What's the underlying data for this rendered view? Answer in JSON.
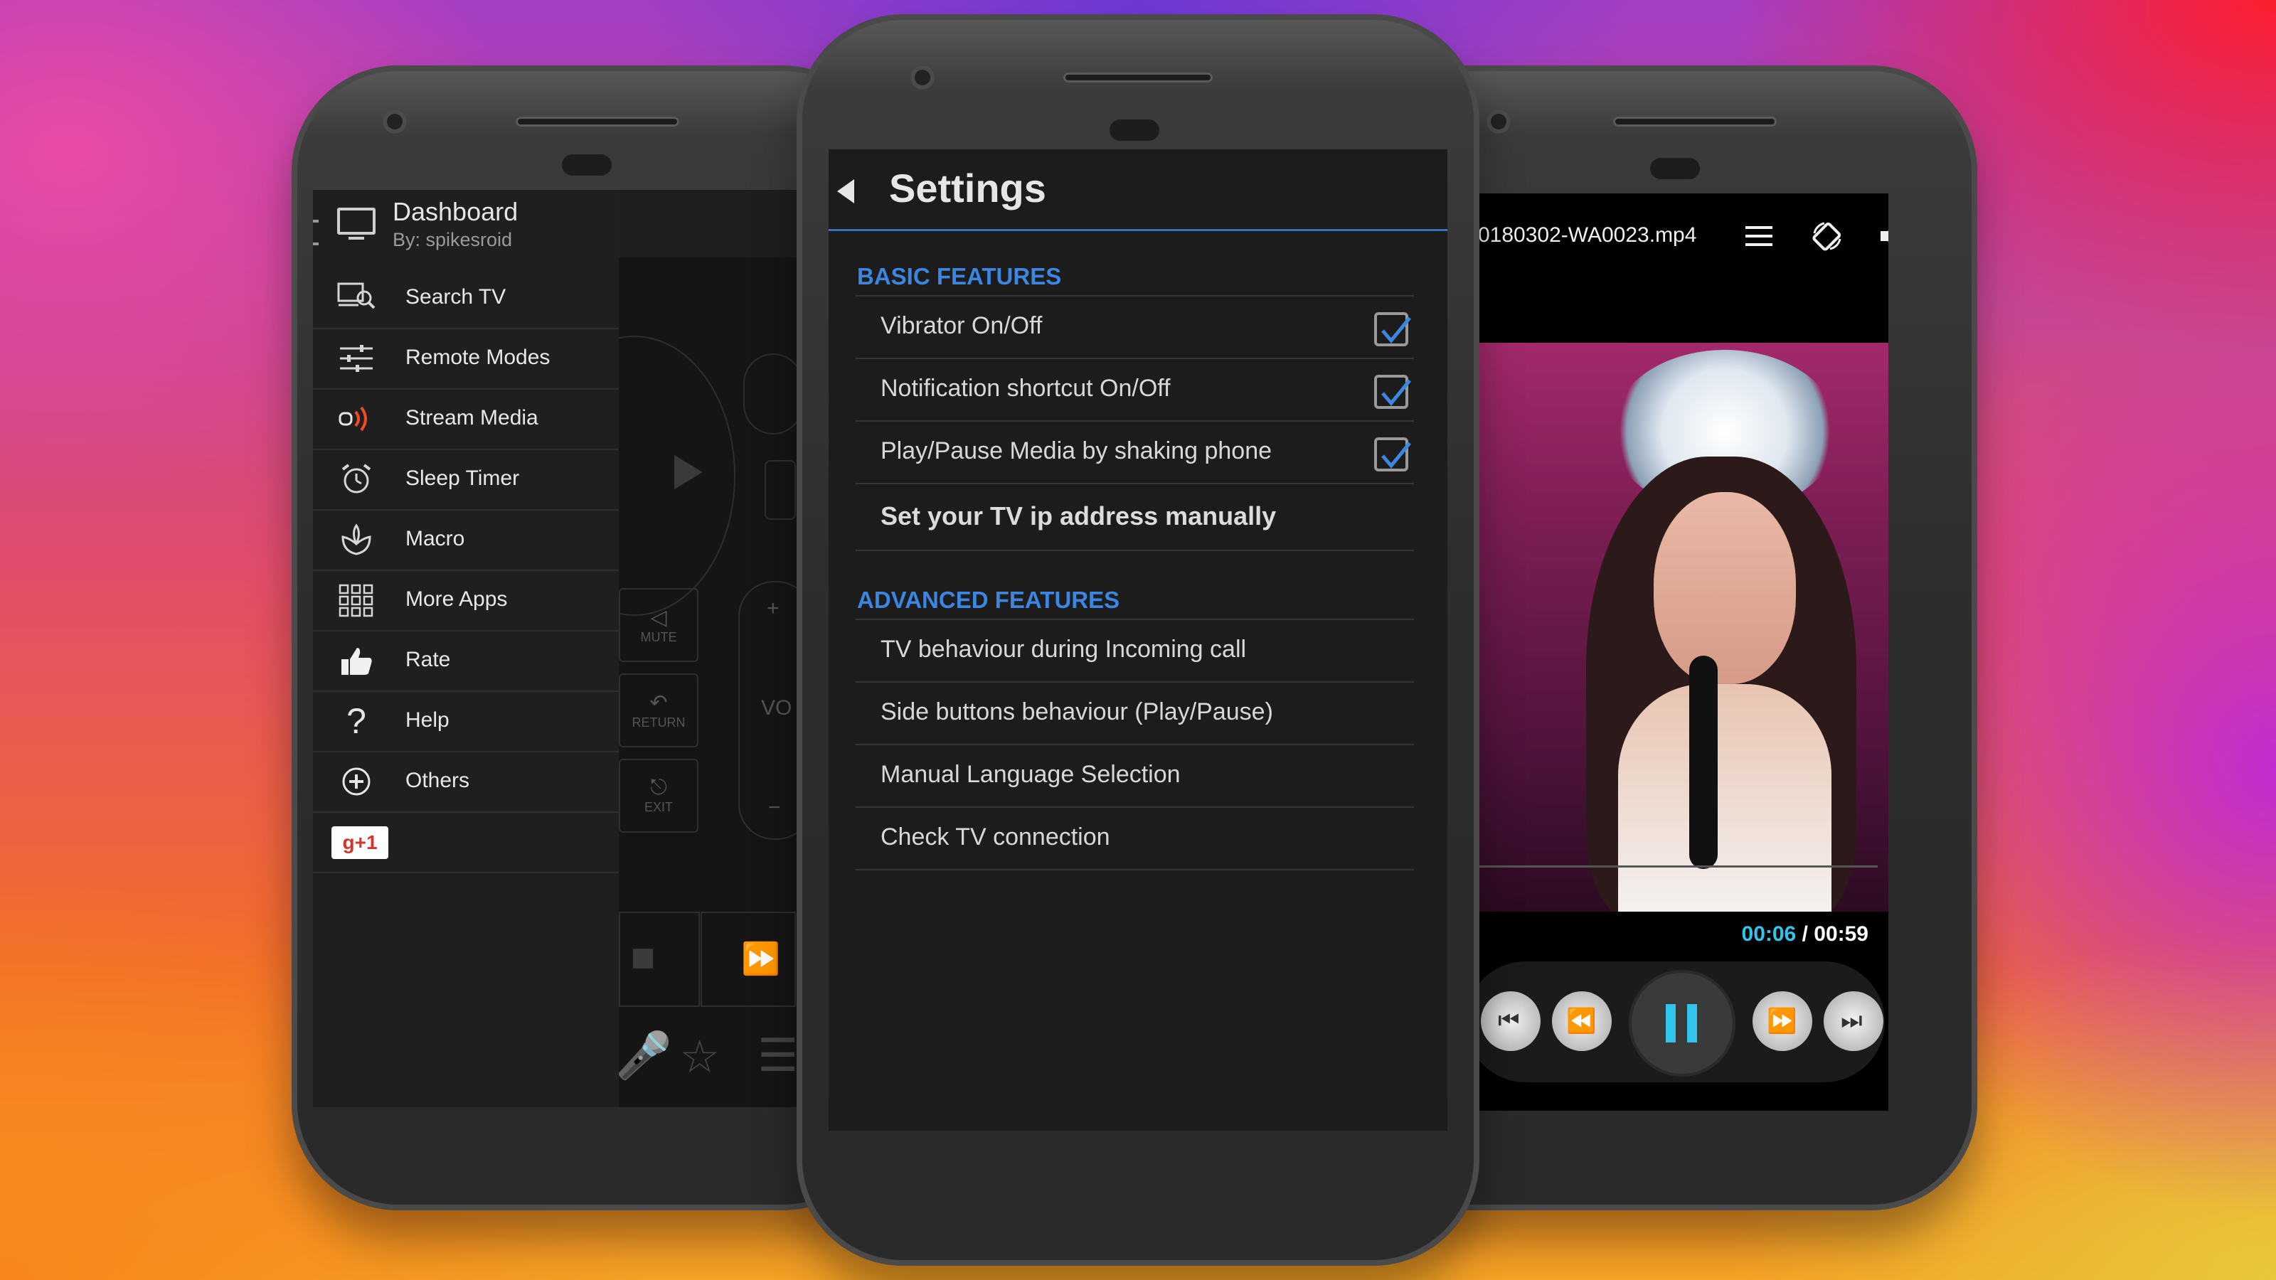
{
  "left_phone": {
    "drawer": {
      "title": "Dashboard",
      "subtitle": "By: spikesroid",
      "items": [
        {
          "label": "Search TV",
          "icon": "search-tv-icon"
        },
        {
          "label": "Remote Modes",
          "icon": "sliders-icon"
        },
        {
          "label": "Stream Media",
          "icon": "stream-media-icon"
        },
        {
          "label": "Sleep Timer",
          "icon": "alarm-clock-icon"
        },
        {
          "label": "Macro",
          "icon": "macro-icon"
        },
        {
          "label": "More Apps",
          "icon": "grid-icon"
        },
        {
          "label": "Rate",
          "icon": "thumbs-up-icon"
        },
        {
          "label": "Help",
          "icon": "question-icon"
        },
        {
          "label": "Others",
          "icon": "plus-circle-icon"
        }
      ],
      "gplus_label": "g+1"
    },
    "remote": {
      "mute_label": "MUTE",
      "return_label": "RETURN",
      "exit_label": "EXIT",
      "vol_label": "VO"
    }
  },
  "middle_phone": {
    "title": "Settings",
    "basic_section": "BASIC FEATURES",
    "basic_items": [
      {
        "label": "Vibrator On/Off",
        "checked": true
      },
      {
        "label": "Notification shortcut On/Off",
        "checked": true
      },
      {
        "label": "Play/Pause Media by shaking phone",
        "checked": true
      }
    ],
    "ip_item": "Set your TV ip address manually",
    "advanced_section": "ADVANCED FEATURES",
    "advanced_items": [
      "TV behaviour during Incoming call",
      "Side buttons behaviour (Play/Pause)",
      "Manual Language Selection",
      "Check TV connection"
    ]
  },
  "right_phone": {
    "filename": "0180302-WA0023.mp4",
    "time_current": "00:06",
    "time_separator": " / ",
    "time_total": "00:59",
    "accent_color": "#33c4ec"
  }
}
